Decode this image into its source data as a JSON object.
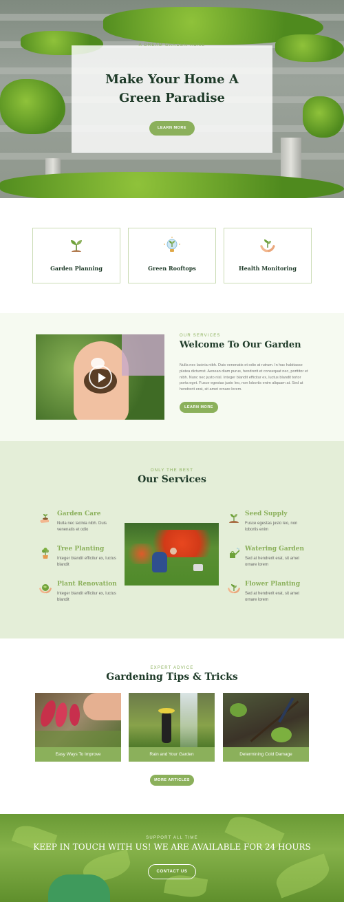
{
  "colors": {
    "accent": "#8bb05b",
    "dark_green": "#1e3a28",
    "services_bg": "#e4eed8",
    "welcome_bg": "#f6faf1"
  },
  "hero": {
    "eyebrow": "A DREAM GARDEN HOME",
    "title": "Make Your Home A Green Paradise",
    "button": "LEARN MORE"
  },
  "features": [
    {
      "label": "Garden Planning",
      "icon": "sprout-icon"
    },
    {
      "label": "Green Rooftops",
      "icon": "lightbulb-plant-icon"
    },
    {
      "label": "Health Monitoring",
      "icon": "hands-plant-icon"
    }
  ],
  "welcome": {
    "eyebrow": "OUR SERVICES",
    "title": "Welcome To Our Garden",
    "body": "Nulla nec lacinia nibh. Duis venenatis et odio at rutrum. In hac habitasse platea dictumst. Aenean diam purus, hendrerit et consequat nec, porttitor et nibh. Nunc nec justo nisl. Integer blandit efficitur ex, luctus blandit tortor porta eget. Fusce egestas justo leo, non lobortis enim aliquam at. Sed at hendrerit erat, sit amet ornare lorem.",
    "button": "LEARN MORE"
  },
  "services": {
    "eyebrow": "ONLY THE BEST",
    "title": "Our Services",
    "left": [
      {
        "title": "Garden Care",
        "text": "Nulla nec lacinia nibh. Duis venenatis et odio",
        "icon": "watering-hand-icon"
      },
      {
        "title": "Tree Planting",
        "text": "Integer blandit efficitur ex, luctus blandit",
        "icon": "potted-tree-icon"
      },
      {
        "title": "Plant Renovation",
        "text": "Integer blandit efficitur ex, luctus blandit",
        "icon": "hands-globe-icon"
      }
    ],
    "right": [
      {
        "title": "Seed Supply",
        "text": "Fusce egestas justo leo, non lobortis enim",
        "icon": "seedling-soil-icon"
      },
      {
        "title": "Watering Garden",
        "text": "Sed at hendrerit erat, sit amet ornare lorem",
        "icon": "watering-can-icon"
      },
      {
        "title": "Flower Planting",
        "text": "Sed at hendrerit erat, sit amet ornare lorem",
        "icon": "hands-sprout-icon"
      }
    ]
  },
  "tips": {
    "eyebrow": "EXPERT ADVICE",
    "title": "Gardening Tips & Tricks",
    "items": [
      {
        "caption": "Easy Ways To Improve"
      },
      {
        "caption": "Rain and Your Garden"
      },
      {
        "caption": "Determining Cold Damage"
      }
    ],
    "button": "MORE ARTICLES"
  },
  "contact": {
    "eyebrow": "SUPPORT ALL TIME",
    "title": "KEEP IN TOUCH WITH US! WE ARE AVAILABLE FOR 24 HOURS",
    "button": "CONTACT US"
  }
}
